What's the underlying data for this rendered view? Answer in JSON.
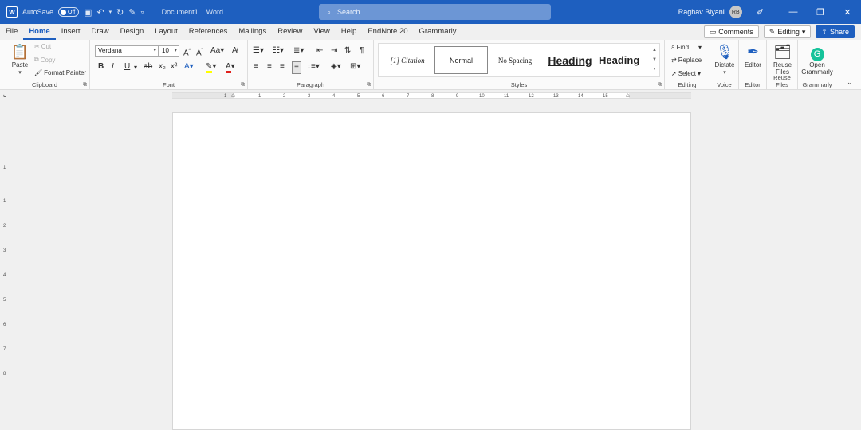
{
  "titlebar": {
    "autosave_label": "AutoSave",
    "autosave_state": "Off",
    "document_name": "Document1",
    "app_name": "Word",
    "search_placeholder": "Search",
    "user_name": "Raghav Biyani",
    "user_initials": "RB"
  },
  "menu": {
    "tabs": [
      "File",
      "Home",
      "Insert",
      "Draw",
      "Design",
      "Layout",
      "References",
      "Mailings",
      "Review",
      "View",
      "Help",
      "EndNote 20",
      "Grammarly"
    ],
    "active": "Home",
    "comments_label": "Comments",
    "editing_label": "Editing",
    "share_label": "Share"
  },
  "ribbon": {
    "clipboard": {
      "paste": "Paste",
      "cut": "Cut",
      "copy": "Copy",
      "format_painter": "Format Painter",
      "label": "Clipboard"
    },
    "font": {
      "family": "Verdana",
      "size": "10",
      "label": "Font"
    },
    "paragraph": {
      "label": "Paragraph"
    },
    "styles": {
      "label": "Styles",
      "items": [
        "[1]  Citation",
        "Normal",
        "No Spacing",
        "Heading",
        "Heading"
      ]
    },
    "editing": {
      "find": "Find",
      "replace": "Replace",
      "select": "Select",
      "label": "Editing"
    },
    "voice": {
      "dictate": "Dictate",
      "label": "Voice"
    },
    "editor": {
      "editor": "Editor",
      "label": "Editor"
    },
    "reuse": {
      "line1": "Reuse",
      "line2": "Files",
      "label": "Reuse Files"
    },
    "grammarly": {
      "line1": "Open",
      "line2": "Grammarly",
      "label": "Grammarly"
    }
  },
  "ruler": {
    "ticks": [
      "1",
      "1",
      "2",
      "3",
      "4",
      "5",
      "6",
      "7",
      "8",
      "9",
      "10",
      "11",
      "12",
      "13",
      "14",
      "15"
    ]
  },
  "vruler": {
    "ticks": [
      "1",
      "1",
      "2",
      "3",
      "4",
      "5",
      "6",
      "7",
      "8"
    ]
  },
  "colors": {
    "accent": "#1e5fbf",
    "highlight": "#ffff00",
    "font_color": "#e0201b"
  }
}
